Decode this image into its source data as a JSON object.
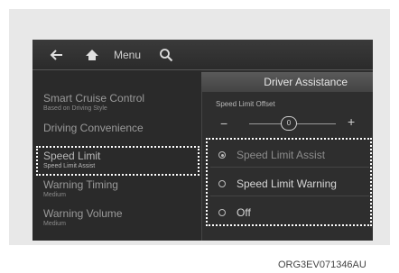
{
  "topbar": {
    "menu_label": "Menu"
  },
  "icons": {
    "back": "back-arrow-icon",
    "home": "home-icon",
    "search": "search-icon"
  },
  "panel": {
    "title": "Driver Assistance"
  },
  "left_menu": {
    "items": [
      {
        "label": "Smart Cruise Control",
        "sub": "Based on Driving Style"
      },
      {
        "label": "Driving Convenience",
        "sub": ""
      },
      {
        "label": "Speed Limit",
        "sub": "Speed Limit Assist"
      },
      {
        "label": "Warning Timing",
        "sub": "Medium"
      },
      {
        "label": "Warning Volume",
        "sub": "Medium"
      }
    ]
  },
  "right": {
    "offset_label": "Speed Limit Offset",
    "minus": "−",
    "plus": "+",
    "offset_value": "0",
    "options": [
      {
        "label": "Speed Limit Assist",
        "selected": true
      },
      {
        "label": "Speed Limit Warning",
        "selected": false
      },
      {
        "label": "Off",
        "selected": false
      }
    ]
  },
  "caption": "ORG3EV071346AU"
}
